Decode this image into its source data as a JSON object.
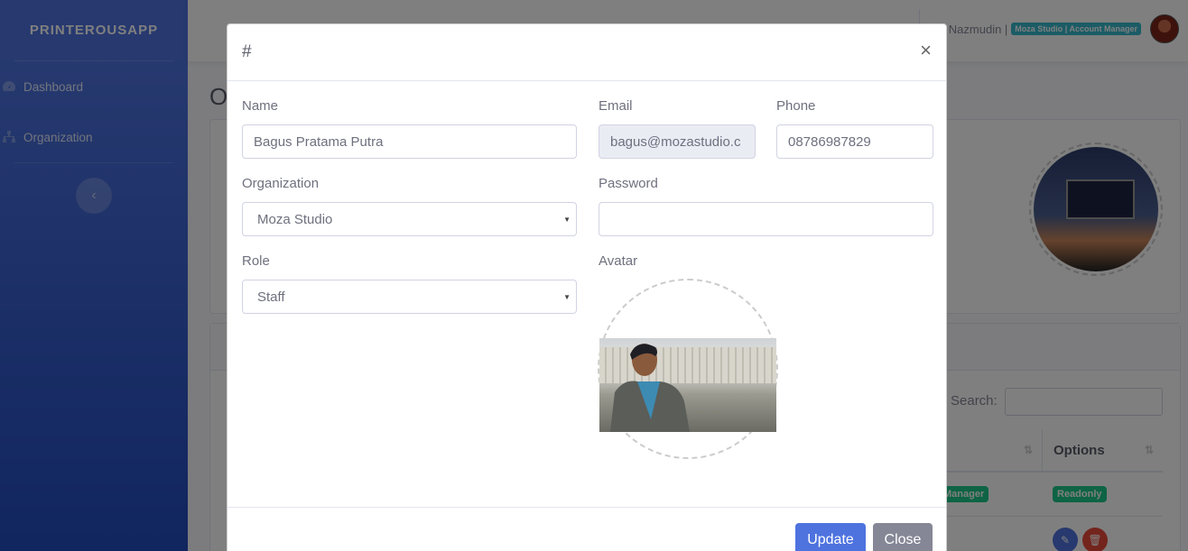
{
  "sidebar": {
    "brand": "PRINTEROUSAPP",
    "items": [
      {
        "label": "Dashboard",
        "icon": "tachometer-icon"
      },
      {
        "label": "Organization",
        "icon": "sitemap-icon"
      }
    ],
    "toggle_icon": "chevron-left-icon"
  },
  "topbar": {
    "user_name": "Nazmudin |",
    "user_badge": "Moza Studio | Account Manager"
  },
  "page": {
    "title_fragment": "O",
    "search_label": "Search:",
    "table_headers": [
      "",
      "Options"
    ],
    "row1": {
      "role_badge": "Manager",
      "option_badge": "Readonly"
    }
  },
  "modal": {
    "title": "#",
    "close_label": "×",
    "fields": {
      "name": {
        "label": "Name",
        "value": "Bagus Pratama Putra"
      },
      "email": {
        "label": "Email",
        "value": "bagus@mozastudio.c"
      },
      "phone": {
        "label": "Phone",
        "value": "08786987829"
      },
      "organization": {
        "label": "Organization",
        "value": "Moza Studio"
      },
      "password": {
        "label": "Password",
        "value": ""
      },
      "role": {
        "label": "Role",
        "value": "Staff"
      },
      "avatar": {
        "label": "Avatar"
      }
    },
    "buttons": {
      "update": "Update",
      "close": "Close"
    }
  },
  "colors": {
    "primary": "#4e73df",
    "success": "#1cc88a",
    "info": "#36b9cc",
    "danger": "#e74a3b",
    "secondary": "#858796"
  }
}
